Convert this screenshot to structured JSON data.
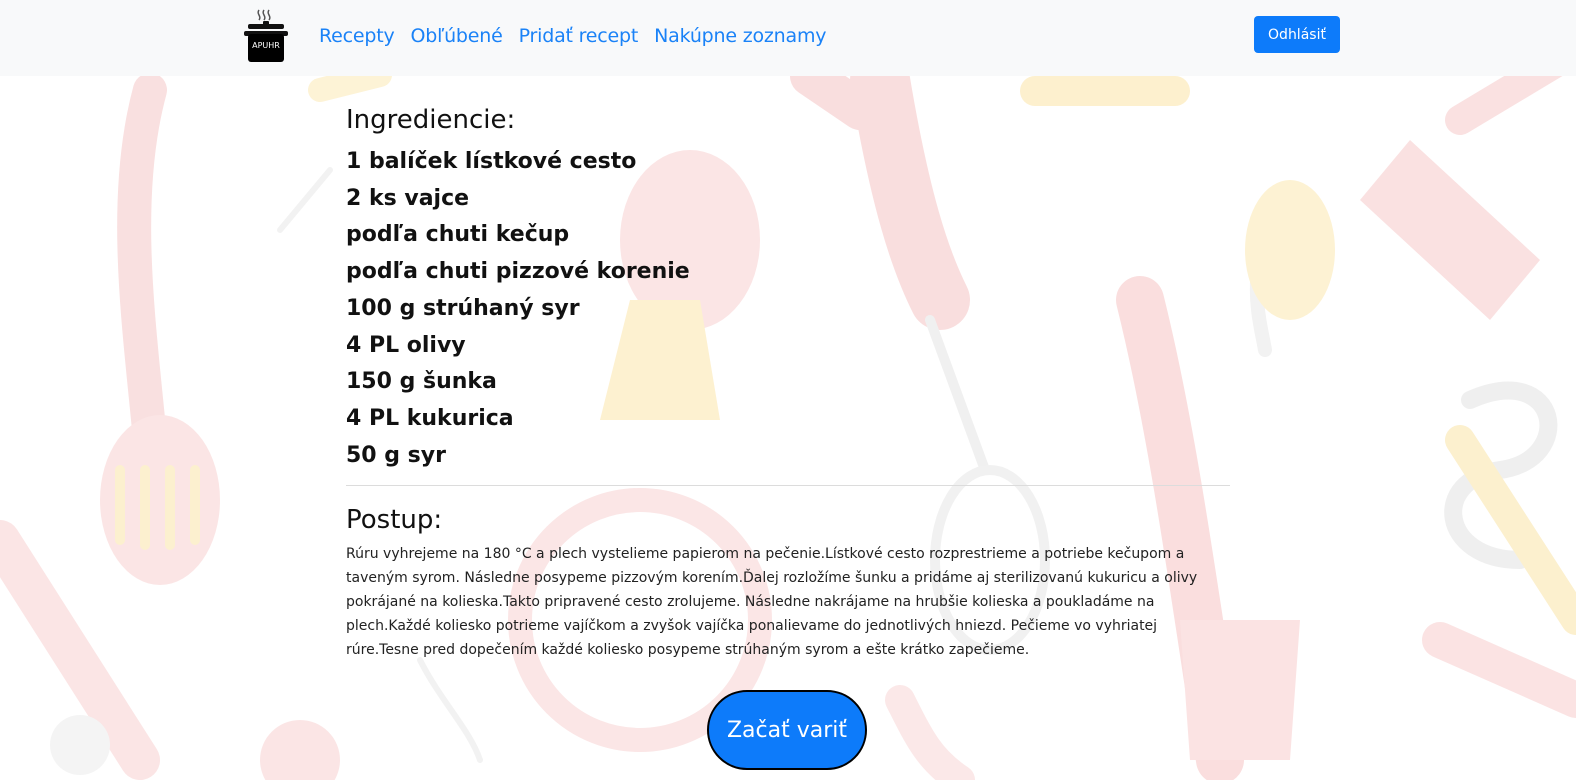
{
  "navbar": {
    "logo_text": "APUHR",
    "links": [
      "Recepty",
      "Obľúbené",
      "Pridať recept",
      "Nakúpne zoznamy"
    ],
    "logout_label": "Odhlásiť"
  },
  "recipe": {
    "ingredients_title": "Ingrediencie:",
    "ingredients": [
      "1 balíček lístkové cesto",
      "2 ks vajce",
      "podľa chuti kečup",
      "podľa chuti pizzové korenie",
      "100 g strúhaný syr",
      "4 PL olivy",
      "150 g šunka",
      "4 PL kukurica",
      "50 g syr"
    ],
    "procedure_title": "Postup:",
    "procedure_text": "Rúru vyhrejeme na 180 °C a plech vystelieme papierom na pečenie.Lístkové cesto rozprestrieme a potriebe kečupom a taveným syrom. Následne posypeme pizzovým korením.Ďalej rozložíme šunku a pridáme aj sterilizovanú kukuricu a olivy pokrájané na kolieska.Takto pripravené cesto zrolujeme. Následne nakrájame na hrubšie kolieska a poukladáme na plech.Každé koliesko potrieme vajíčkom a zvyšok vajíčka ponalievame do jednotlivých hniezd. Pečieme vo vyhriatej rúre.Tesne pred dopečením každé koliesko posypeme strúhaným syrom a ešte krátko zapečieme."
  },
  "start_button_label": "Začať variť",
  "colors": {
    "link": "#1a82f7",
    "primary_button": "#0d7bfa",
    "navbar_bg": "#f8f9fa"
  }
}
